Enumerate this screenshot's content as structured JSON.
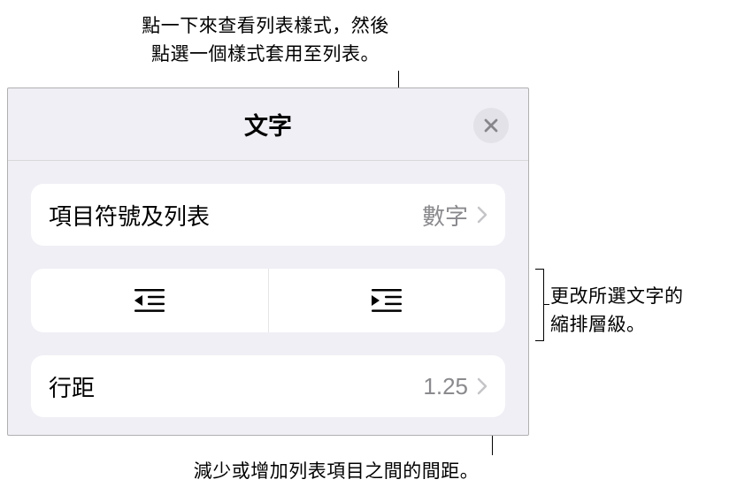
{
  "callouts": {
    "top_line1": "點一下來查看列表樣式，然後",
    "top_line2": "點選一個樣式套用至列表。",
    "right_line1": "更改所選文字的",
    "right_line2": "縮排層級。",
    "bottom": "減少或增加列表項目之間的間距。"
  },
  "panel": {
    "title": "文字",
    "bullets": {
      "label": "項目符號及列表",
      "value": "數字"
    },
    "lineSpacing": {
      "label": "行距",
      "value": "1.25"
    }
  }
}
